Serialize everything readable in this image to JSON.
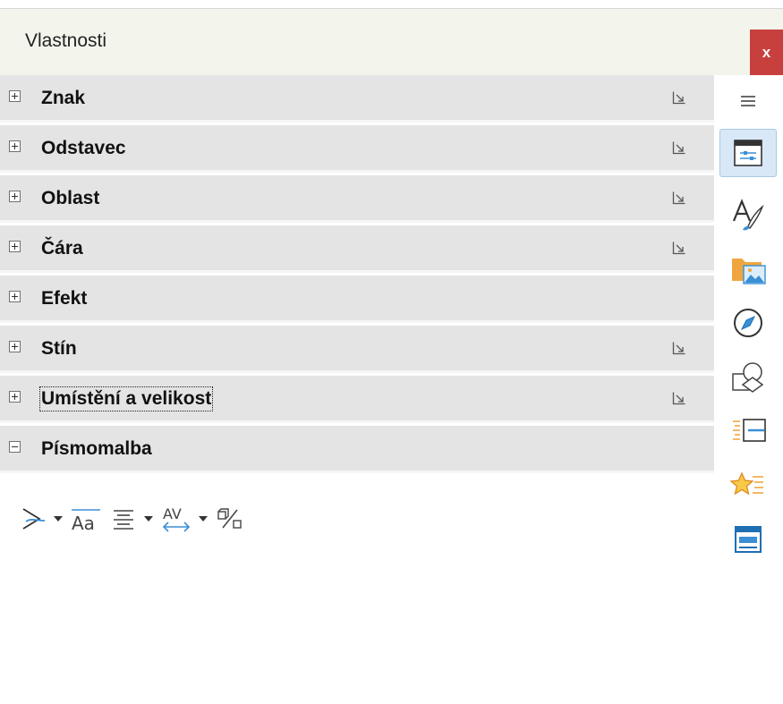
{
  "window": {
    "title": "Vlastnosti",
    "close_label": "x"
  },
  "sections": [
    {
      "label": "Znak",
      "expanded": false,
      "has_more": true
    },
    {
      "label": "Odstavec",
      "expanded": false,
      "has_more": true
    },
    {
      "label": "Oblast",
      "expanded": false,
      "has_more": true
    },
    {
      "label": "Čára",
      "expanded": false,
      "has_more": true
    },
    {
      "label": "Efekt",
      "expanded": false,
      "has_more": false
    },
    {
      "label": "Stín",
      "expanded": false,
      "has_more": true
    },
    {
      "label": "Umístění a velikost",
      "expanded": false,
      "has_more": true,
      "focused": true
    },
    {
      "label": "Písmomalba",
      "expanded": true,
      "has_more": false
    }
  ],
  "fontwork_toolbar": [
    {
      "icon": "fontwork-shape-icon",
      "dropdown": true
    },
    {
      "icon": "same-letter-heights-icon",
      "dropdown": false
    },
    {
      "icon": "fontwork-alignment-icon",
      "dropdown": true
    },
    {
      "icon": "character-spacing-icon",
      "dropdown": true
    },
    {
      "icon": "toggle-extrusion-icon",
      "dropdown": false
    }
  ],
  "sidebar_tabs": [
    {
      "icon": "menu-icon",
      "active": false
    },
    {
      "icon": "properties-icon",
      "active": true
    },
    {
      "icon": "styles-icon",
      "active": false
    },
    {
      "icon": "gallery-icon",
      "active": false
    },
    {
      "icon": "navigator-icon",
      "active": false
    },
    {
      "icon": "shapes-icon",
      "active": false
    },
    {
      "icon": "slide-transition-icon",
      "active": false
    },
    {
      "icon": "animation-icon",
      "active": false
    },
    {
      "icon": "master-slides-icon",
      "active": false
    }
  ],
  "colors": {
    "section_bg": "#e4e4e4",
    "title_bg": "#f3f4ec",
    "close_bg": "#c8403e",
    "accent_blue": "#3a8fd6",
    "active_tab_bg": "#d9e8f7"
  }
}
